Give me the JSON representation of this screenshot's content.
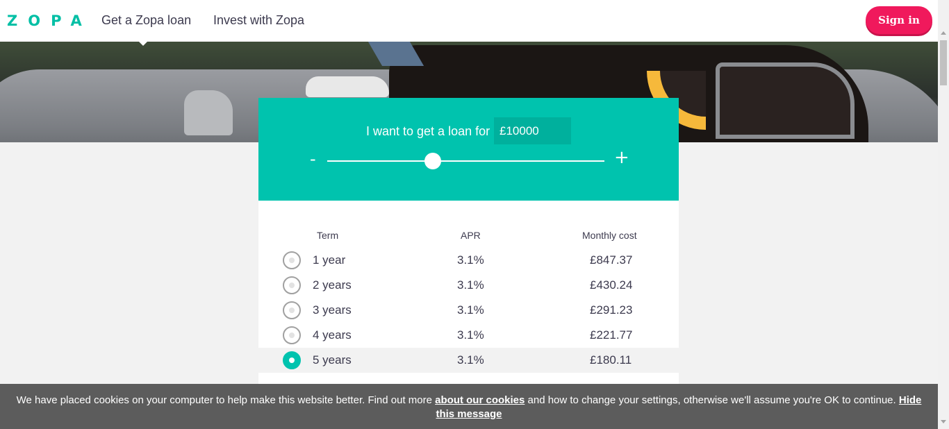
{
  "header": {
    "logo": "ZOPA",
    "nav": [
      {
        "label": "Get a Zopa loan"
      },
      {
        "label": "Invest with Zopa"
      }
    ],
    "signin_label": "Sign in"
  },
  "calculator": {
    "prompt": "I want to get a loan for",
    "amount": "£10000",
    "minus_label": "-",
    "plus_label": "+",
    "slider_level": 0.38,
    "columns": {
      "term": "Term",
      "apr": "APR",
      "cost": "Monthly cost"
    },
    "rows": [
      {
        "term": "1 year",
        "apr": "3.1%",
        "cost": "£847.37",
        "selected": false
      },
      {
        "term": "2 years",
        "apr": "3.1%",
        "cost": "£430.24",
        "selected": false
      },
      {
        "term": "3 years",
        "apr": "3.1%",
        "cost": "£291.23",
        "selected": false
      },
      {
        "term": "4 years",
        "apr": "3.1%",
        "cost": "£221.77",
        "selected": false
      },
      {
        "term": "5 years",
        "apr": "3.1%",
        "cost": "£180.11",
        "selected": true
      }
    ]
  },
  "cookie": {
    "text_1": "We have placed cookies on your computer to help make this website better. Find out more ",
    "link_1": "about our cookies",
    "text_2": " and how to change your settings, otherwise we'll assume you're OK to continue. ",
    "link_2": "Hide this message"
  },
  "colors": {
    "brand": "#00c3ae",
    "signin": "#f0195c",
    "accent": "#f6b93b"
  }
}
